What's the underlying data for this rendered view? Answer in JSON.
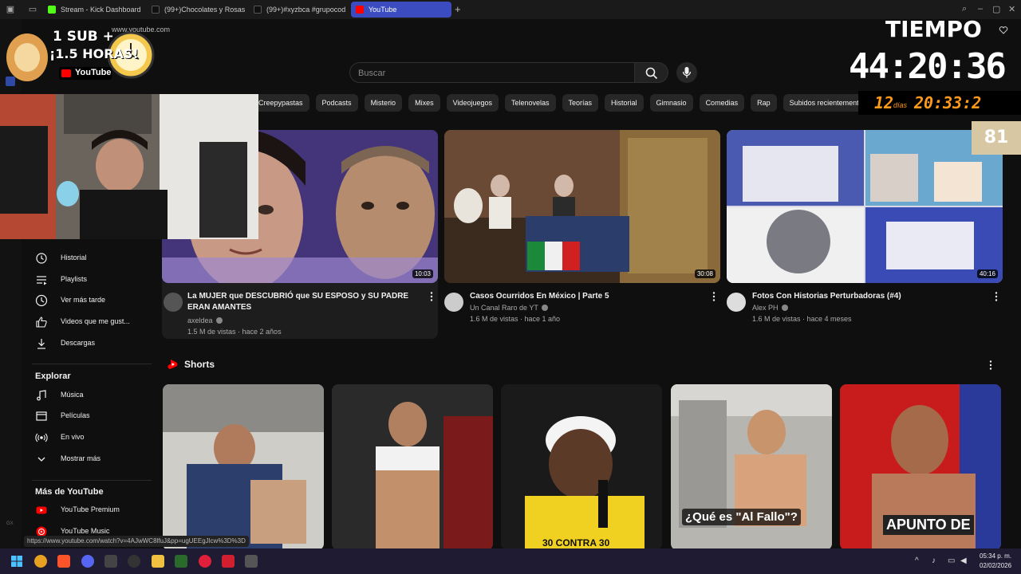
{
  "browser": {
    "tabs": [
      {
        "label": "Stream - Kick Dashboard",
        "icon": "kick-icon",
        "color": "#53fc18"
      },
      {
        "label": "(99+)Chocolates y Rosas:",
        "icon": "tiktok-icon",
        "color": "#222222"
      },
      {
        "label": "(99+)#xyzbca #grupocod",
        "icon": "tiktok-icon",
        "color": "#222222"
      },
      {
        "label": "YouTube",
        "icon": "youtube-icon",
        "color": "#ff0000"
      }
    ],
    "url": "www.youtube.com"
  },
  "header": {
    "search_placeholder": "Buscar"
  },
  "chips": [
    "Creepypastas",
    "Podcasts",
    "Misterio",
    "Mixes",
    "Videojuegos",
    "Telenovelas",
    "Teorías",
    "Historial",
    "Gimnasio",
    "Comedias",
    "Rap",
    "Subidos recientemente"
  ],
  "sidebar": {
    "items": [
      {
        "label": "Historial",
        "icon": "history-icon"
      },
      {
        "label": "Playlists",
        "icon": "playlists-icon"
      },
      {
        "label": "Ver más tarde",
        "icon": "watch-later-icon"
      },
      {
        "label": "Videos que me gust...",
        "icon": "thumbs-up-icon"
      },
      {
        "label": "Descargas",
        "icon": "download-icon"
      }
    ],
    "explore_heading": "Explorar",
    "explore_items": [
      {
        "label": "Música",
        "icon": "music-icon"
      },
      {
        "label": "Películas",
        "icon": "movies-icon"
      },
      {
        "label": "En vivo",
        "icon": "live-icon"
      },
      {
        "label": "Mostrar más",
        "icon": "chevron-down-icon"
      }
    ],
    "more_heading": "Más de YouTube",
    "more_items": [
      {
        "label": "YouTube Premium",
        "icon": "youtube-premium-icon"
      },
      {
        "label": "YouTube Music",
        "icon": "youtube-music-icon"
      }
    ]
  },
  "videos": [
    {
      "title": "La MUJER que DESCUBRIÓ que SU ESPOSO y SU PADRE ERAN AMANTES",
      "channel": "axeldea",
      "meta": "1.5 M de vistas · hace 2 años",
      "duration": "10:03"
    },
    {
      "title": "Casos Ocurridos En México | Parte 5",
      "channel": "Un Canal Raro de YT",
      "meta": "1.6 M de vistas · hace 1 año",
      "duration": "30:08"
    },
    {
      "title": "Fotos Con Historias Perturbadoras (#4)",
      "channel": "Alex PH",
      "meta": "1.6 M de vistas · hace 4 meses",
      "duration": "40:16"
    }
  ],
  "shorts": {
    "heading": "Shorts",
    "captions": [
      "",
      "",
      "30 CONTRA 30",
      "¿Qué es \"Al Fallo\"?",
      "APUNTO DE"
    ]
  },
  "overlay": {
    "logo_line1": "1 SUB +",
    "logo_line2": "¡1.5 HORAS!",
    "logo_brand": "YouTube",
    "timer_label": "TIEMPO",
    "timer_value": "44:20:36",
    "countdown_days": "12",
    "countdown_days_label": "días",
    "countdown_time": "20:33:2",
    "badge_count": "81"
  },
  "status_url": "https://www.youtube.com/watch?v=4AJwWC8lfuJ&pp=ugUEEgJlcw%3D%3D",
  "taskbar": {
    "time": "05:34 p. m.",
    "date": "02/02/2026"
  }
}
